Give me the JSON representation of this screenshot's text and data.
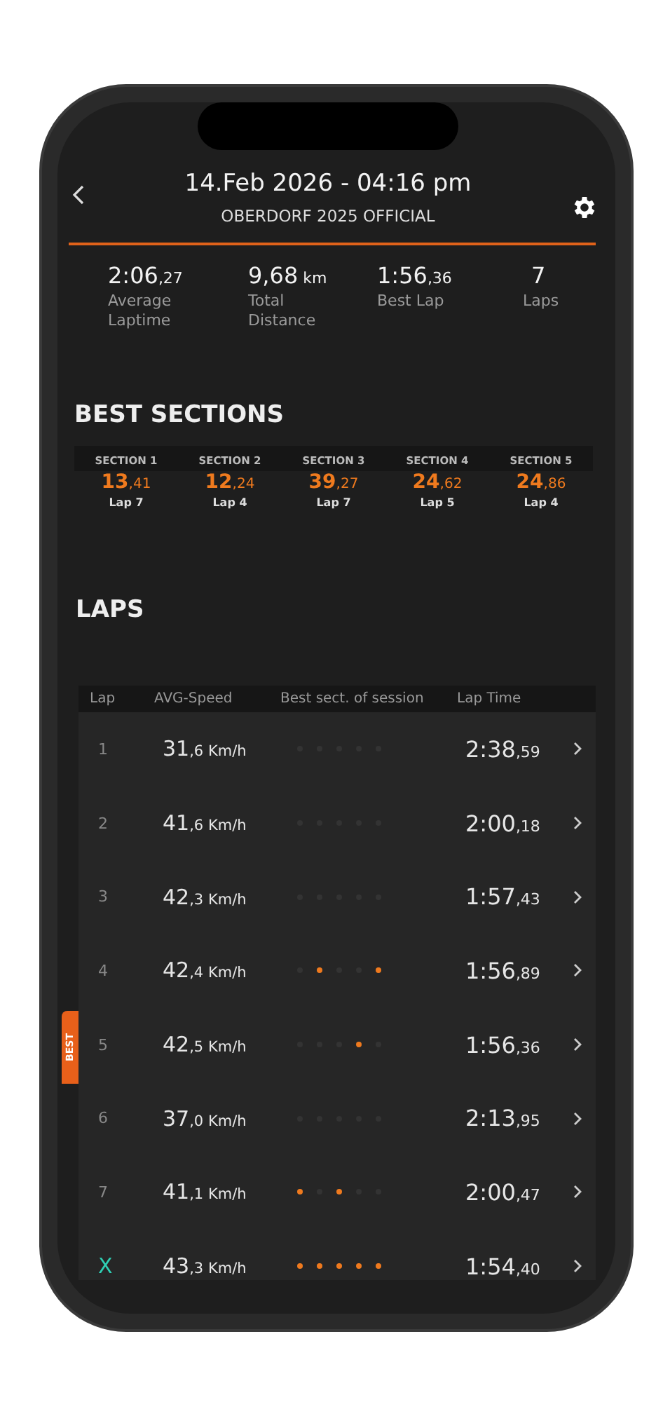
{
  "header": {
    "title": "14.Feb 2026 - 04:16 pm",
    "subtitle": "OBERDORF 2025 OFFICIAL"
  },
  "stats": [
    {
      "value": "2:06",
      "fraction": ",27",
      "label": "Average Laptime"
    },
    {
      "value": "9,68",
      "fraction": " km",
      "label": "Total Distance"
    },
    {
      "value": "1:56",
      "fraction": ",36",
      "label": "Best Lap"
    },
    {
      "value": "7",
      "label": "Laps"
    }
  ],
  "best_sections": {
    "title": "BEST SECTIONS",
    "sections": [
      {
        "name": "SECTION 1",
        "value": "13",
        "fraction": ",41",
        "lap": "Lap 7"
      },
      {
        "name": "SECTION 2",
        "value": "12",
        "fraction": ",24",
        "lap": "Lap 4"
      },
      {
        "name": "SECTION 3",
        "value": "39",
        "fraction": ",27",
        "lap": "Lap 7"
      },
      {
        "name": "SECTION 4",
        "value": "24",
        "fraction": ",62",
        "lap": "Lap 5"
      },
      {
        "name": "SECTION 5",
        "value": "24",
        "fraction": ",86",
        "lap": "Lap 4"
      }
    ]
  },
  "laps": {
    "title": "LAPS",
    "columns": [
      "Lap",
      "AVG-Speed",
      "Best sect. of session",
      "Lap Time"
    ],
    "rows": [
      {
        "kind": "lap",
        "lap": "1",
        "speed": "31",
        "speed_fraction": ",6 Km/h",
        "best_sections": [
          false,
          false,
          false,
          false,
          false
        ],
        "time": "2:38",
        "time_fraction": ",59",
        "best": false
      },
      {
        "kind": "lap",
        "lap": "2",
        "speed": "41",
        "speed_fraction": ",6 Km/h",
        "best_sections": [
          false,
          false,
          false,
          false,
          false
        ],
        "time": "2:00",
        "time_fraction": ",18",
        "best": false
      },
      {
        "kind": "lap",
        "lap": "3",
        "speed": "42",
        "speed_fraction": ",3 Km/h",
        "best_sections": [
          false,
          false,
          false,
          false,
          false
        ],
        "time": "1:57",
        "time_fraction": ",43",
        "best": false
      },
      {
        "kind": "lap",
        "lap": "4",
        "speed": "42",
        "speed_fraction": ",4 Km/h",
        "best_sections": [
          false,
          true,
          false,
          false,
          true
        ],
        "time": "1:56",
        "time_fraction": ",89",
        "best": false
      },
      {
        "kind": "lap",
        "lap": "5",
        "speed": "42",
        "speed_fraction": ",5 Km/h",
        "best_sections": [
          false,
          false,
          false,
          true,
          false
        ],
        "time": "1:56",
        "time_fraction": ",36",
        "best": true,
        "badge": "BEST"
      },
      {
        "kind": "lap",
        "lap": "6",
        "speed": "37",
        "speed_fraction": ",0 Km/h",
        "best_sections": [
          false,
          false,
          false,
          false,
          false
        ],
        "time": "2:13",
        "time_fraction": ",95",
        "best": false
      },
      {
        "kind": "lap",
        "lap": "7",
        "speed": "41",
        "speed_fraction": ",1 Km/h",
        "best_sections": [
          true,
          false,
          true,
          false,
          false
        ],
        "time": "2:00",
        "time_fraction": ",47",
        "best": false
      },
      {
        "kind": "ideal",
        "lap": "X",
        "speed": "43",
        "speed_fraction": ",3 Km/h",
        "best_sections": [
          true,
          true,
          true,
          true,
          true
        ],
        "time": "1:54",
        "time_fraction": ",40",
        "best": false
      }
    ]
  }
}
